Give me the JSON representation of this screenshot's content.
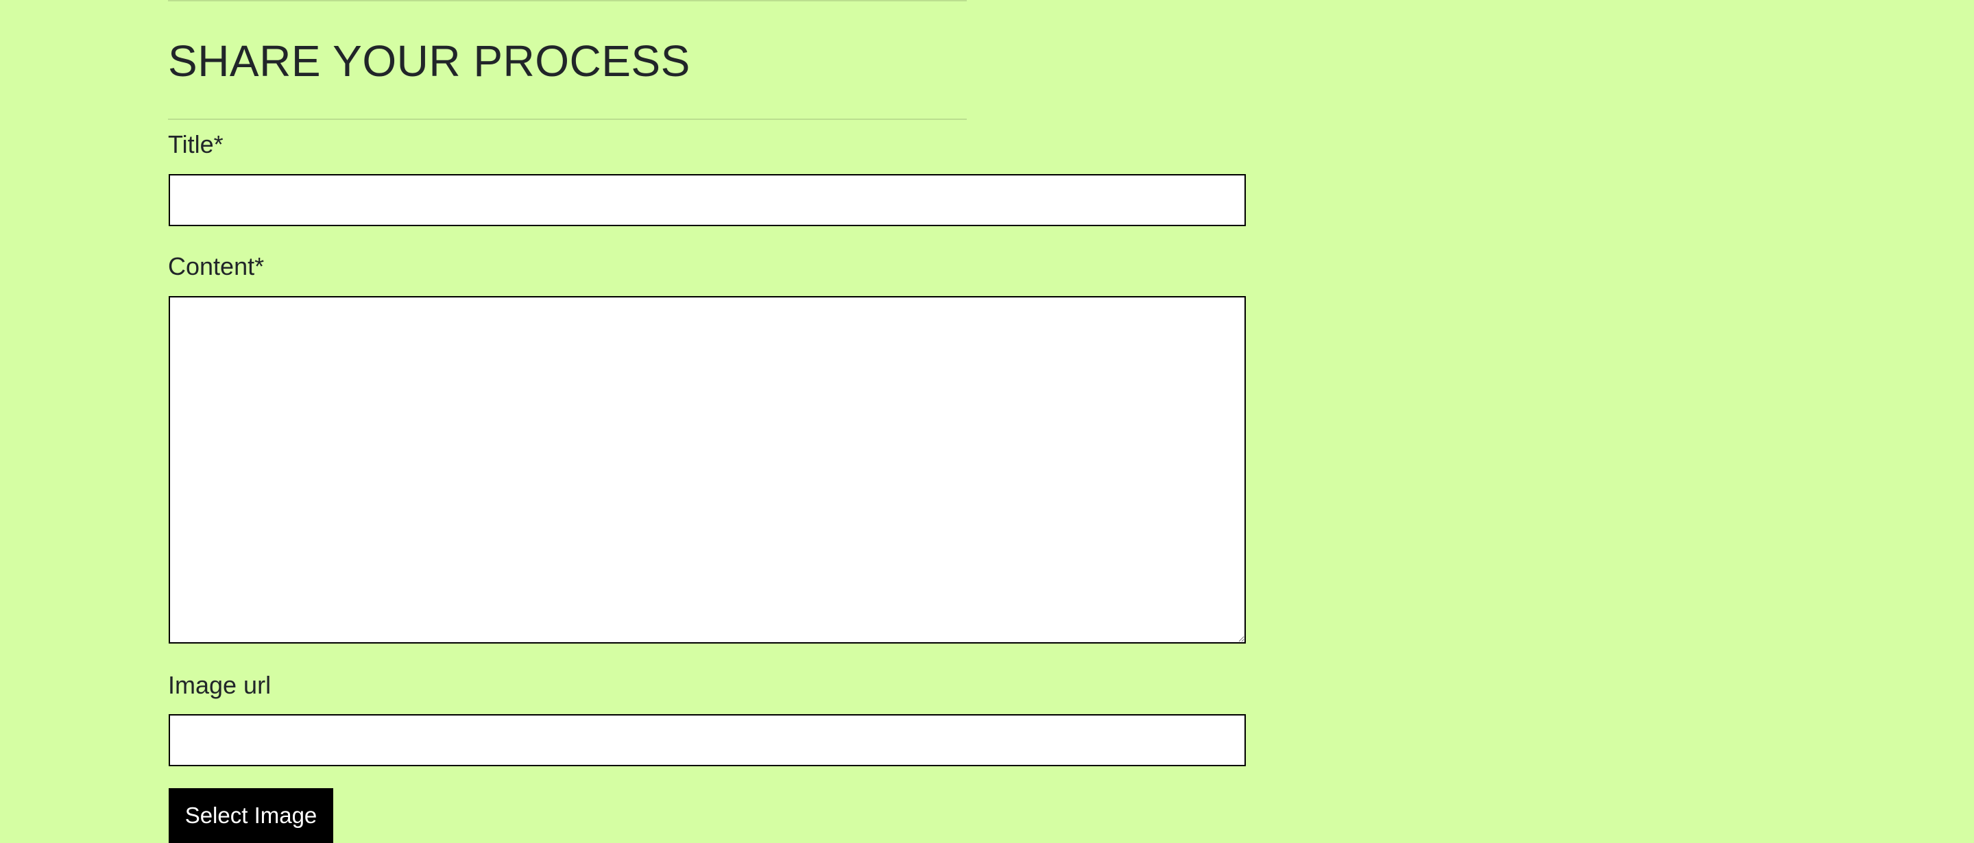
{
  "form": {
    "heading": "SHARE YOUR PROCESS",
    "fields": {
      "title": {
        "label": "Title*",
        "value": "",
        "placeholder": ""
      },
      "content": {
        "label": "Content*",
        "value": "",
        "placeholder": ""
      },
      "image_url": {
        "label": "Image url",
        "value": "",
        "placeholder": ""
      }
    },
    "select_image_label": "Select Image"
  },
  "colors": {
    "background": "#d5fea3",
    "text": "#212529",
    "button_background": "#000000",
    "button_text": "#ffffff",
    "input_border": "#000000"
  }
}
